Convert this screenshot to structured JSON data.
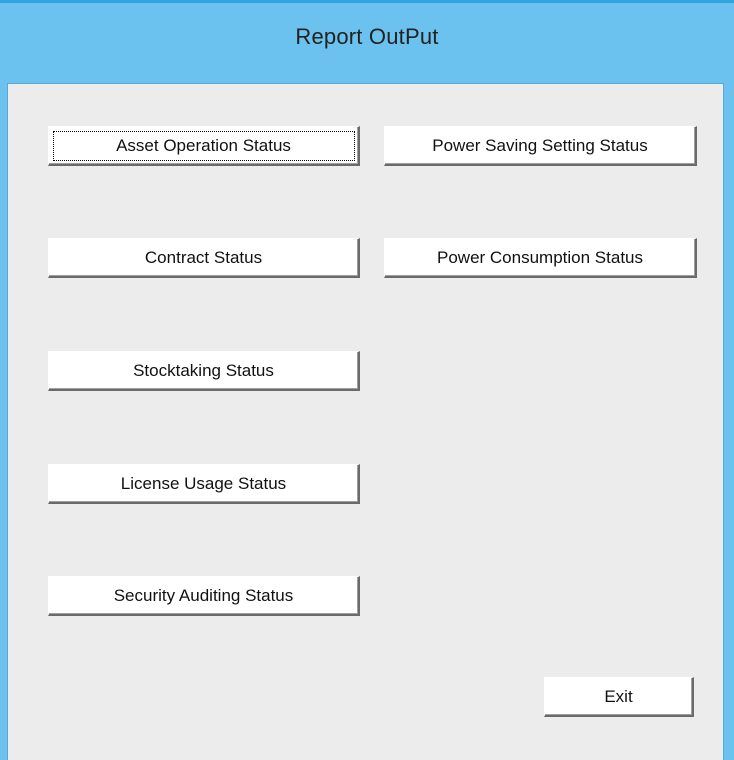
{
  "window": {
    "title": "Report OutPut"
  },
  "buttons": {
    "asset_operation": "Asset Operation Status",
    "power_saving_setting": "Power Saving Setting Status",
    "contract": "Contract Status",
    "power_consumption": "Power Consumption Status",
    "stocktaking": "Stocktaking Status",
    "license_usage": "License Usage Status",
    "security_auditing": "Security Auditing Status",
    "exit": "Exit"
  },
  "colors": {
    "title_bar": "#6cc2ee",
    "client_background": "#ececec",
    "button_face": "#ffffff"
  }
}
